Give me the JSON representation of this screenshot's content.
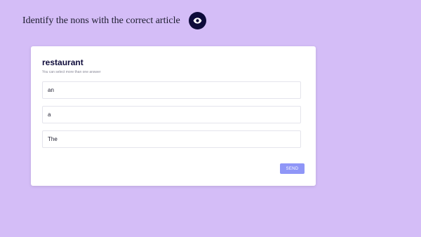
{
  "header": {
    "instruction": "Identify the nons with the correct article",
    "eye_icon": "eye-icon"
  },
  "question": {
    "word": "restaurant",
    "hint": "You can select more than one answer",
    "options": [
      {
        "label": "an"
      },
      {
        "label": "a"
      },
      {
        "label": "The"
      }
    ],
    "send_label": "SEND"
  },
  "colors": {
    "background": "#d4bdf7",
    "accent_dark": "#0e0b3a",
    "send_button": "#8f96f7"
  }
}
